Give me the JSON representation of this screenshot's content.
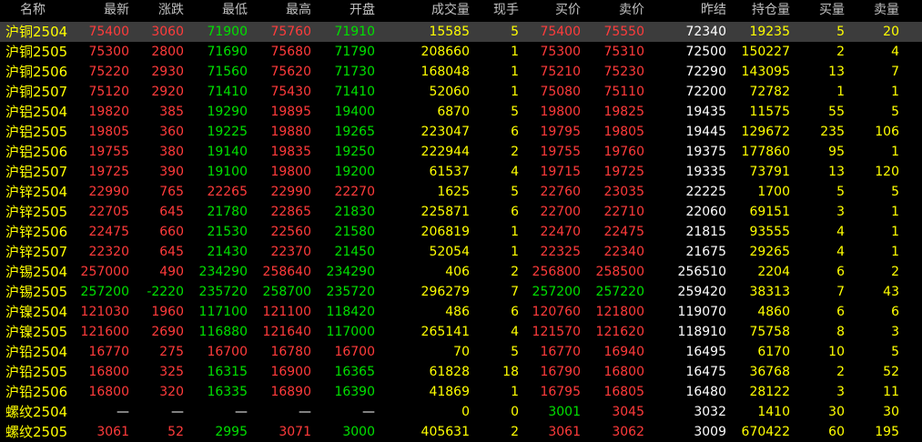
{
  "headers": [
    "名称",
    "最新",
    "涨跌",
    "最低",
    "最高",
    "开盘",
    "成交量",
    "现手",
    "买价",
    "卖价",
    "昨结",
    "持仓量",
    "买量",
    "卖量"
  ],
  "colors": {
    "up": "#ff3b3b",
    "down": "#00e000",
    "vol": "#ffff00",
    "flat": "#ffffff",
    "selected_bg": "#3c3c3c"
  },
  "selected_row": 0,
  "rows": [
    {
      "name": "沪铜2504",
      "last": "75400",
      "chg": "3060",
      "low": "71900",
      "high": "75760",
      "open": "71910",
      "vol": "15585",
      "cur": "5",
      "bid": "75400",
      "ask": "75550",
      "pre": "72340",
      "oi": "19235",
      "bidv": "5",
      "askv": "20",
      "cc": {
        "last": "red",
        "chg": "red",
        "low": "green",
        "high": "red",
        "open": "green",
        "bid": "red",
        "ask": "red"
      }
    },
    {
      "name": "沪铜2505",
      "last": "75300",
      "chg": "2800",
      "low": "71690",
      "high": "75680",
      "open": "71790",
      "vol": "208660",
      "cur": "1",
      "bid": "75300",
      "ask": "75310",
      "pre": "72500",
      "oi": "150227",
      "bidv": "2",
      "askv": "4",
      "cc": {
        "last": "red",
        "chg": "red",
        "low": "green",
        "high": "red",
        "open": "green",
        "bid": "red",
        "ask": "red"
      }
    },
    {
      "name": "沪铜2506",
      "last": "75220",
      "chg": "2930",
      "low": "71560",
      "high": "75620",
      "open": "71730",
      "vol": "168048",
      "cur": "1",
      "bid": "75210",
      "ask": "75230",
      "pre": "72290",
      "oi": "143095",
      "bidv": "13",
      "askv": "7",
      "cc": {
        "last": "red",
        "chg": "red",
        "low": "green",
        "high": "red",
        "open": "green",
        "bid": "red",
        "ask": "red"
      }
    },
    {
      "name": "沪铜2507",
      "last": "75120",
      "chg": "2920",
      "low": "71410",
      "high": "75430",
      "open": "71410",
      "vol": "52060",
      "cur": "1",
      "bid": "75080",
      "ask": "75110",
      "pre": "72200",
      "oi": "72782",
      "bidv": "1",
      "askv": "1",
      "cc": {
        "last": "red",
        "chg": "red",
        "low": "green",
        "high": "red",
        "open": "green",
        "bid": "red",
        "ask": "red"
      }
    },
    {
      "name": "沪铝2504",
      "last": "19820",
      "chg": "385",
      "low": "19290",
      "high": "19895",
      "open": "19400",
      "vol": "6870",
      "cur": "5",
      "bid": "19800",
      "ask": "19825",
      "pre": "19435",
      "oi": "11575",
      "bidv": "55",
      "askv": "5",
      "cc": {
        "last": "red",
        "chg": "red",
        "low": "green",
        "high": "red",
        "open": "green",
        "bid": "red",
        "ask": "red"
      }
    },
    {
      "name": "沪铝2505",
      "last": "19805",
      "chg": "360",
      "low": "19225",
      "high": "19880",
      "open": "19265",
      "vol": "223047",
      "cur": "6",
      "bid": "19795",
      "ask": "19805",
      "pre": "19445",
      "oi": "129672",
      "bidv": "235",
      "askv": "106",
      "cc": {
        "last": "red",
        "chg": "red",
        "low": "green",
        "high": "red",
        "open": "green",
        "bid": "red",
        "ask": "red"
      }
    },
    {
      "name": "沪铝2506",
      "last": "19755",
      "chg": "380",
      "low": "19140",
      "high": "19835",
      "open": "19250",
      "vol": "222944",
      "cur": "2",
      "bid": "19755",
      "ask": "19760",
      "pre": "19375",
      "oi": "177860",
      "bidv": "95",
      "askv": "1",
      "cc": {
        "last": "red",
        "chg": "red",
        "low": "green",
        "high": "red",
        "open": "green",
        "bid": "red",
        "ask": "red"
      }
    },
    {
      "name": "沪铝2507",
      "last": "19725",
      "chg": "390",
      "low": "19100",
      "high": "19800",
      "open": "19200",
      "vol": "61537",
      "cur": "4",
      "bid": "19715",
      "ask": "19725",
      "pre": "19335",
      "oi": "73791",
      "bidv": "13",
      "askv": "120",
      "cc": {
        "last": "red",
        "chg": "red",
        "low": "green",
        "high": "red",
        "open": "green",
        "bid": "red",
        "ask": "red"
      }
    },
    {
      "name": "沪锌2504",
      "last": "22990",
      "chg": "765",
      "low": "22265",
      "high": "22990",
      "open": "22270",
      "vol": "1625",
      "cur": "5",
      "bid": "22760",
      "ask": "23035",
      "pre": "22225",
      "oi": "1700",
      "bidv": "5",
      "askv": "5",
      "cc": {
        "last": "red",
        "chg": "red",
        "low": "red",
        "high": "red",
        "open": "red",
        "bid": "red",
        "ask": "red"
      }
    },
    {
      "name": "沪锌2505",
      "last": "22705",
      "chg": "645",
      "low": "21780",
      "high": "22865",
      "open": "21830",
      "vol": "225871",
      "cur": "6",
      "bid": "22700",
      "ask": "22710",
      "pre": "22060",
      "oi": "69151",
      "bidv": "3",
      "askv": "1",
      "cc": {
        "last": "red",
        "chg": "red",
        "low": "green",
        "high": "red",
        "open": "green",
        "bid": "red",
        "ask": "red"
      }
    },
    {
      "name": "沪锌2506",
      "last": "22475",
      "chg": "660",
      "low": "21530",
      "high": "22560",
      "open": "21580",
      "vol": "206819",
      "cur": "1",
      "bid": "22470",
      "ask": "22475",
      "pre": "21815",
      "oi": "93555",
      "bidv": "4",
      "askv": "1",
      "cc": {
        "last": "red",
        "chg": "red",
        "low": "green",
        "high": "red",
        "open": "green",
        "bid": "red",
        "ask": "red"
      }
    },
    {
      "name": "沪锌2507",
      "last": "22320",
      "chg": "645",
      "low": "21430",
      "high": "22370",
      "open": "21450",
      "vol": "52054",
      "cur": "1",
      "bid": "22325",
      "ask": "22340",
      "pre": "21675",
      "oi": "29265",
      "bidv": "4",
      "askv": "1",
      "cc": {
        "last": "red",
        "chg": "red",
        "low": "green",
        "high": "red",
        "open": "green",
        "bid": "red",
        "ask": "red"
      }
    },
    {
      "name": "沪锡2504",
      "last": "257000",
      "chg": "490",
      "low": "234290",
      "high": "258640",
      "open": "234290",
      "vol": "406",
      "cur": "2",
      "bid": "256800",
      "ask": "258500",
      "pre": "256510",
      "oi": "2204",
      "bidv": "6",
      "askv": "2",
      "cc": {
        "last": "red",
        "chg": "red",
        "low": "green",
        "high": "red",
        "open": "green",
        "bid": "red",
        "ask": "red"
      }
    },
    {
      "name": "沪锡2505",
      "last": "257200",
      "chg": "-2220",
      "low": "235720",
      "high": "258700",
      "open": "235720",
      "vol": "296279",
      "cur": "7",
      "bid": "257200",
      "ask": "257220",
      "pre": "259420",
      "oi": "38313",
      "bidv": "7",
      "askv": "43",
      "cc": {
        "last": "green",
        "chg": "green",
        "low": "green",
        "high": "green",
        "open": "green",
        "bid": "green",
        "ask": "green"
      }
    },
    {
      "name": "沪镍2504",
      "last": "121030",
      "chg": "1960",
      "low": "117100",
      "high": "121100",
      "open": "118420",
      "vol": "486",
      "cur": "6",
      "bid": "120760",
      "ask": "121800",
      "pre": "119070",
      "oi": "4860",
      "bidv": "6",
      "askv": "6",
      "cc": {
        "last": "red",
        "chg": "red",
        "low": "green",
        "high": "red",
        "open": "green",
        "bid": "red",
        "ask": "red"
      }
    },
    {
      "name": "沪镍2505",
      "last": "121600",
      "chg": "2690",
      "low": "116880",
      "high": "121640",
      "open": "117000",
      "vol": "265141",
      "cur": "4",
      "bid": "121570",
      "ask": "121620",
      "pre": "118910",
      "oi": "75758",
      "bidv": "8",
      "askv": "3",
      "cc": {
        "last": "red",
        "chg": "red",
        "low": "green",
        "high": "red",
        "open": "green",
        "bid": "red",
        "ask": "red"
      }
    },
    {
      "name": "沪铅2504",
      "last": "16770",
      "chg": "275",
      "low": "16700",
      "high": "16780",
      "open": "16700",
      "vol": "70",
      "cur": "5",
      "bid": "16770",
      "ask": "16940",
      "pre": "16495",
      "oi": "6170",
      "bidv": "10",
      "askv": "5",
      "cc": {
        "last": "red",
        "chg": "red",
        "low": "red",
        "high": "red",
        "open": "red",
        "bid": "red",
        "ask": "red"
      }
    },
    {
      "name": "沪铅2505",
      "last": "16800",
      "chg": "325",
      "low": "16315",
      "high": "16900",
      "open": "16365",
      "vol": "61828",
      "cur": "18",
      "bid": "16790",
      "ask": "16800",
      "pre": "16475",
      "oi": "36768",
      "bidv": "2",
      "askv": "52",
      "cc": {
        "last": "red",
        "chg": "red",
        "low": "green",
        "high": "red",
        "open": "green",
        "bid": "red",
        "ask": "red"
      }
    },
    {
      "name": "沪铅2506",
      "last": "16800",
      "chg": "320",
      "low": "16335",
      "high": "16890",
      "open": "16390",
      "vol": "41869",
      "cur": "1",
      "bid": "16795",
      "ask": "16805",
      "pre": "16480",
      "oi": "28122",
      "bidv": "3",
      "askv": "11",
      "cc": {
        "last": "red",
        "chg": "red",
        "low": "green",
        "high": "red",
        "open": "green",
        "bid": "red",
        "ask": "red"
      }
    },
    {
      "name": "螺纹2504",
      "last": "—",
      "chg": "—",
      "low": "—",
      "high": "—",
      "open": "—",
      "vol": "0",
      "cur": "0",
      "bid": "3001",
      "ask": "3045",
      "pre": "3032",
      "oi": "1410",
      "bidv": "30",
      "askv": "30",
      "cc": {
        "last": "white",
        "chg": "white",
        "low": "white",
        "high": "white",
        "open": "white",
        "bid": "green",
        "ask": "red"
      }
    },
    {
      "name": "螺纹2505",
      "last": "3061",
      "chg": "52",
      "low": "2995",
      "high": "3071",
      "open": "3000",
      "vol": "405631",
      "cur": "2",
      "bid": "3061",
      "ask": "3062",
      "pre": "3009",
      "oi": "670422",
      "bidv": "60",
      "askv": "195",
      "cc": {
        "last": "red",
        "chg": "red",
        "low": "green",
        "high": "red",
        "open": "green",
        "bid": "red",
        "ask": "red"
      }
    }
  ]
}
